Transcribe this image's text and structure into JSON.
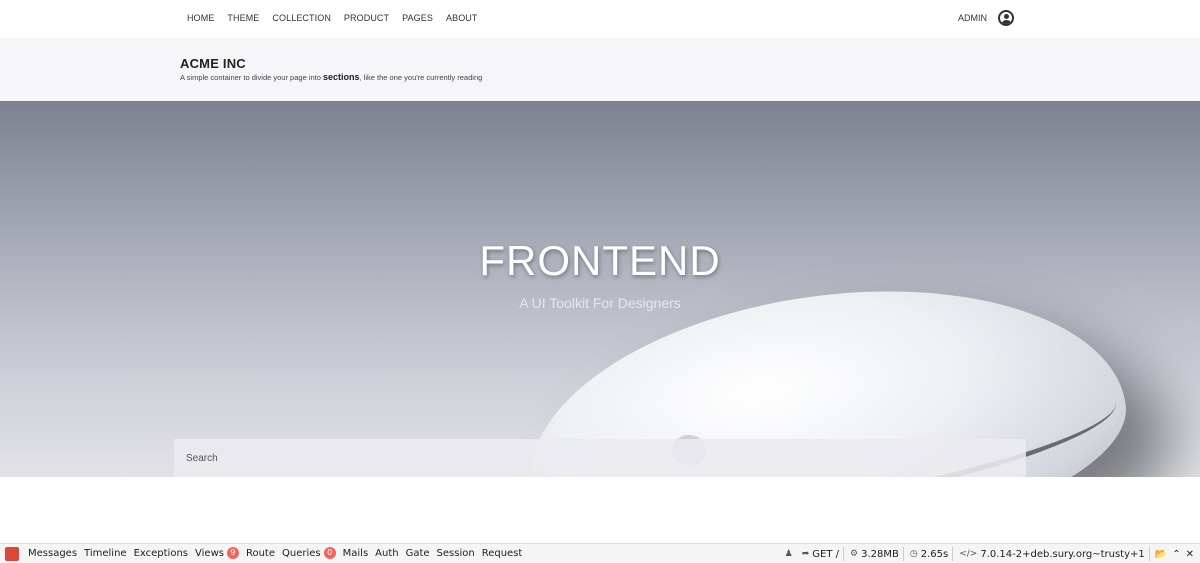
{
  "nav": {
    "items": [
      "HOME",
      "THEME",
      "COLLECTION",
      "PRODUCT",
      "PAGES",
      "ABOUT"
    ],
    "admin_label": "ADMIN",
    "user_icon": "user-circle-icon"
  },
  "section": {
    "title": "ACME INC",
    "subtitle_before": "A simple container to divide your page into ",
    "subtitle_bold": "sections",
    "subtitle_after": ", like the one you're currently reading"
  },
  "hero": {
    "headline": "FRONTEND",
    "tagline": "A UI Toolkit For Designers",
    "search_placeholder": "Search"
  },
  "debugbar": {
    "tabs": [
      {
        "label": "Messages"
      },
      {
        "label": "Timeline"
      },
      {
        "label": "Exceptions"
      },
      {
        "label": "Views",
        "badge": "9"
      },
      {
        "label": "Route"
      },
      {
        "label": "Queries",
        "badge": "0"
      },
      {
        "label": "Mails"
      },
      {
        "label": "Auth"
      },
      {
        "label": "Gate"
      },
      {
        "label": "Session"
      },
      {
        "label": "Request"
      }
    ],
    "method": "GET /",
    "memory": "3.28MB",
    "time": "2.65s",
    "php_version": "7.0.14-2+deb.sury.org~trusty+1",
    "accent": "#f4645f"
  }
}
